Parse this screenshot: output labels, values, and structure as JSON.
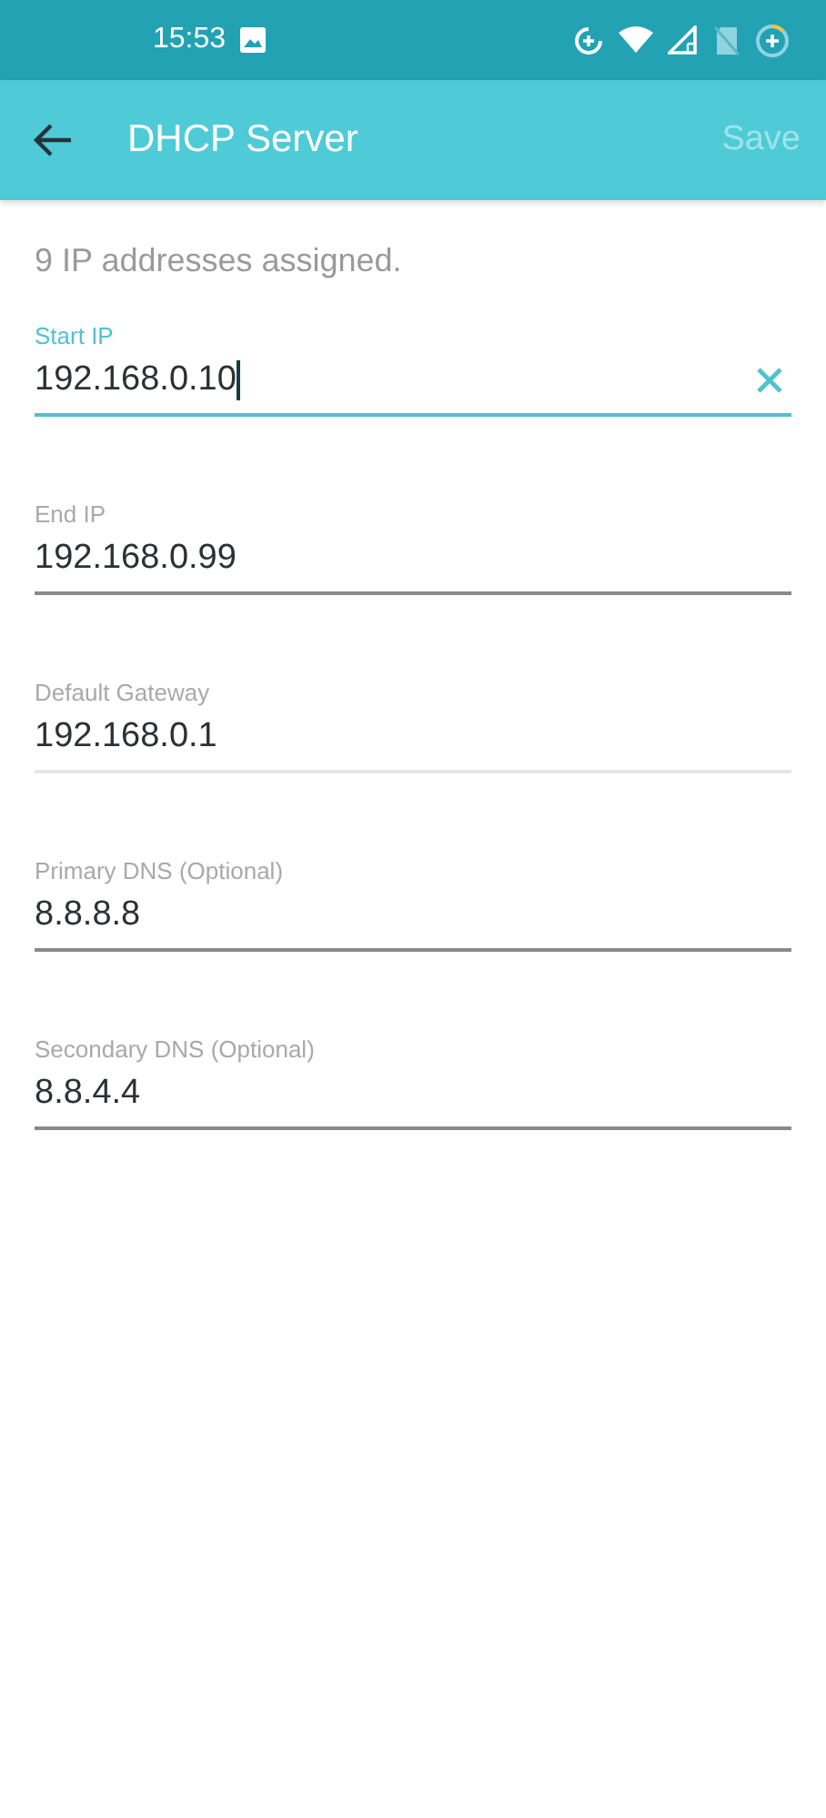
{
  "status_bar": {
    "time": "15:53"
  },
  "app_bar": {
    "title": "DHCP Server",
    "save": {
      "label": "Save",
      "disabled": true
    }
  },
  "summary": "9 IP addresses assigned.",
  "fields": [
    {
      "label": "Start IP",
      "value": "192.168.0.10",
      "focused": true,
      "disabled": false
    },
    {
      "label": "End IP",
      "value": "192.168.0.99",
      "focused": false,
      "disabled": false
    },
    {
      "label": "Default Gateway",
      "value": "192.168.0.1",
      "focused": false,
      "disabled": true
    },
    {
      "label": "Primary DNS (Optional)",
      "value": "8.8.8.8",
      "focused": false,
      "disabled": false
    },
    {
      "label": "Secondary DNS (Optional)",
      "value": "8.8.4.4",
      "focused": false,
      "disabled": false
    }
  ]
}
